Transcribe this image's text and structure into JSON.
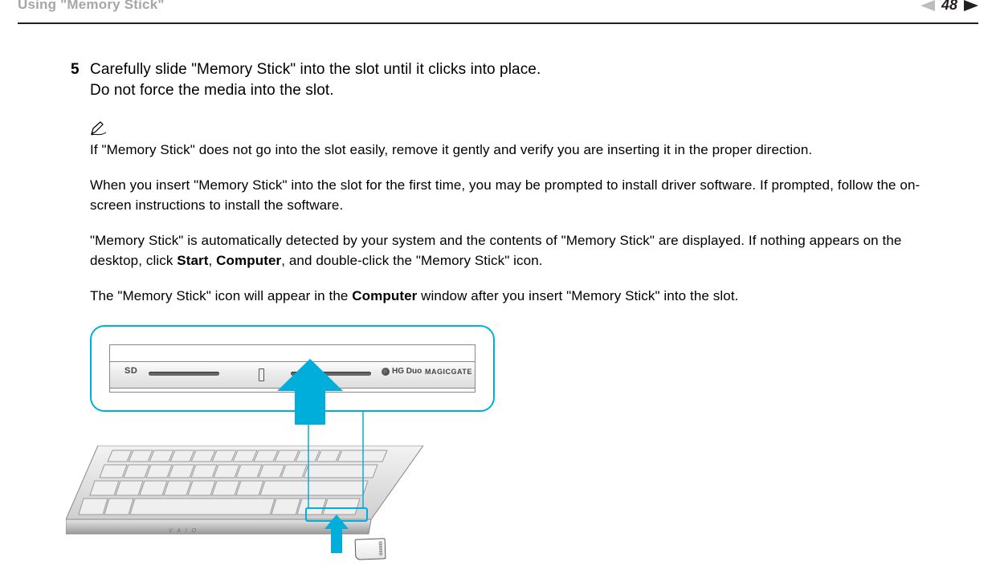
{
  "header": {
    "title": "Using \"Memory Stick\"",
    "page_number": "48",
    "nav_labels": {
      "semantic_text": "n N"
    }
  },
  "step": {
    "number": "5",
    "line1": "Carefully slide \"Memory Stick\" into the slot until it clicks into place.",
    "line2": "Do not force the media into the slot."
  },
  "notes": {
    "icon_name": "pen-icon",
    "p1": "If \"Memory Stick\" does not go into the slot easily, remove it gently and verify you are inserting it in the proper direction.",
    "p2": "When you insert \"Memory Stick\" into the slot for the first time, you may be prompted to install driver software. If prompted, follow the on-screen instructions to install the software.",
    "p3_pre": "\"Memory Stick\" is automatically detected by your system and the contents of \"Memory Stick\" are displayed. If nothing appears on the desktop, click ",
    "p3_b1": "Start",
    "p3_sep1": ", ",
    "p3_b2": "Computer",
    "p3_post": ", and double-click the \"Memory Stick\" icon.",
    "p4_pre": "The \"Memory Stick\" icon will appear in the ",
    "p4_b1": "Computer",
    "p4_post": " window after you insert \"Memory Stick\" into the slot."
  },
  "figure": {
    "sd_label": "SD",
    "hgduo_label": "HG Duo",
    "magicgate_label": "MAGICGATE",
    "accent_color": "#00aedb"
  }
}
